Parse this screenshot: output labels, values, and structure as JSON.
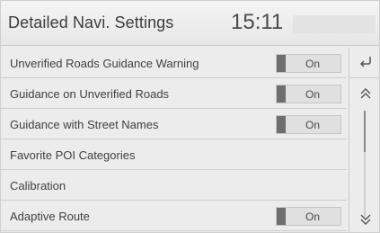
{
  "header": {
    "title": "Detailed Navi. Settings",
    "time": "15:11"
  },
  "settings": [
    {
      "label": "Unverified Roads Guidance Warning",
      "toggle": "On"
    },
    {
      "label": "Guidance on Unverified Roads",
      "toggle": "On"
    },
    {
      "label": "Guidance with Street Names",
      "toggle": "On"
    },
    {
      "label": "Favorite POI Categories"
    },
    {
      "label": "Calibration"
    },
    {
      "label": "Adaptive Route",
      "toggle": "On"
    }
  ],
  "side": {
    "back_icon": "back-arrow-icon",
    "scroll_up_icon": "double-chevron-up-icon",
    "scroll_down_icon": "double-chevron-down-icon",
    "scroll_position": 0
  },
  "colors": {
    "background": "#ececec",
    "text": "#404040",
    "toggle_bg": "#e0e0e0",
    "toggle_indicator": "#6e6e6e"
  }
}
